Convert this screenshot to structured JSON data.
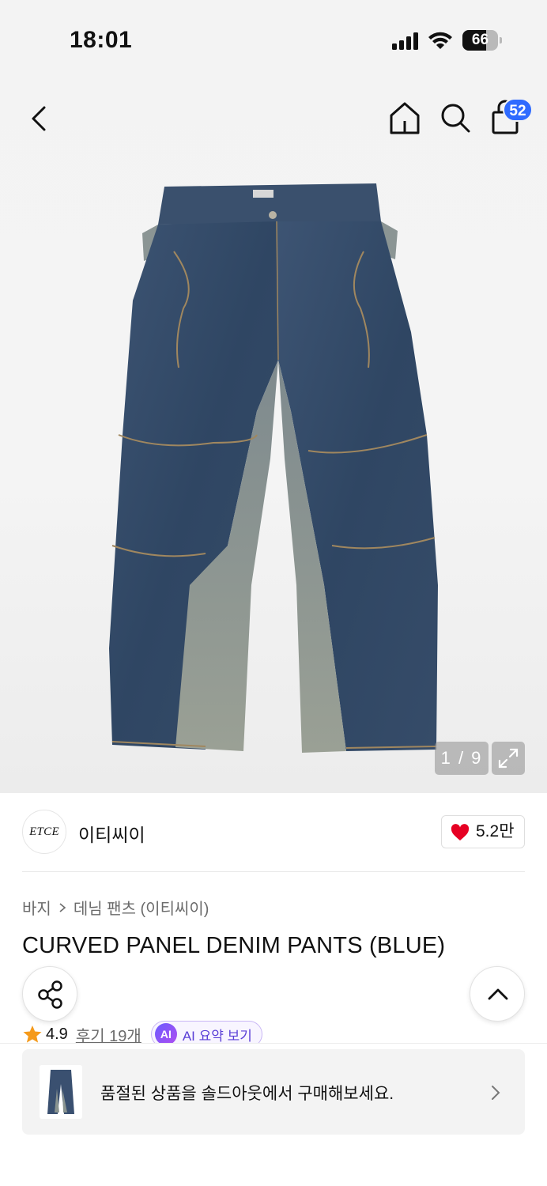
{
  "status_bar": {
    "time": "18:01",
    "battery": "66",
    "icons": [
      "signal-icon",
      "wifi-icon",
      "battery-icon"
    ]
  },
  "nav": {
    "icons": [
      "back-arrow-icon",
      "home-icon",
      "search-icon",
      "shopping-bag-icon"
    ],
    "cart_badge": "52"
  },
  "gallery": {
    "counter": "1 / 9",
    "image_subject": "jeans-icon",
    "expand_icon": "expand-icon"
  },
  "brand": {
    "logo_text": "ETCE",
    "name": "이티씨이",
    "likes": "5.2만"
  },
  "breadcrumb": {
    "items": [
      "바지",
      "데님 팬츠 (이티씨이)"
    ]
  },
  "product": {
    "title": "CURVED PANEL DENIM PANTS (BLUE)"
  },
  "rating": {
    "value": "4.9",
    "reviews": "후기 19개",
    "ai_badge": "AI",
    "ai_label": "AI 요약 보기"
  },
  "soldout": {
    "text": "품절된 상품을 솔드아웃에서 구매해보세요."
  },
  "colors": {
    "accent_blue": "#2f6bff",
    "heart_red": "#e60023",
    "star_orange": "#f59a1b",
    "ai_purple": "#5a3fd6"
  }
}
